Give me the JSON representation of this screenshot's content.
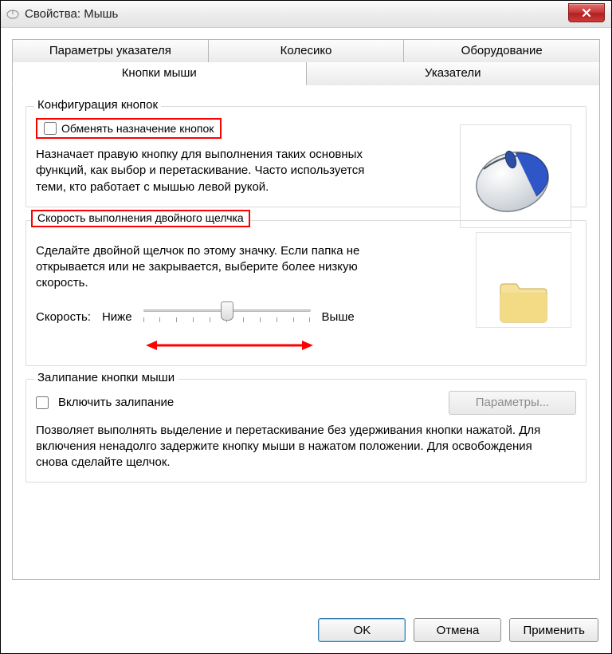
{
  "window": {
    "title": "Свойства: Мышь"
  },
  "tabs": {
    "row1": [
      "Параметры указателя",
      "Колесико",
      "Оборудование"
    ],
    "row2": [
      "Кнопки мыши",
      "Указатели"
    ],
    "active": "Кнопки мыши"
  },
  "group_config": {
    "title": "Конфигурация кнопок",
    "checkbox_label": "Обменять назначение кнопок",
    "description": "Назначает правую кнопку для выполнения таких основных функций, как выбор и перетаскивание. Часто используется теми, кто работает с мышью левой рукой."
  },
  "group_dblclick": {
    "title": "Скорость выполнения двойного щелчка",
    "description": "Сделайте двойной щелчок по этому значку. Если папка не открывается или не закрывается, выберите более низкую скорость.",
    "speed_label": "Скорость:",
    "lower": "Ниже",
    "higher": "Выше"
  },
  "group_clicklock": {
    "title": "Залипание кнопки мыши",
    "checkbox_label": "Включить залипание",
    "params_button": "Параметры...",
    "description": "Позволяет выполнять выделение и перетаскивание без удерживания кнопки нажатой. Для включения ненадолго задержите кнопку мыши в нажатом положении. Для освобождения снова сделайте щелчок."
  },
  "buttons": {
    "ok": "OK",
    "cancel": "Отмена",
    "apply": "Применить"
  }
}
